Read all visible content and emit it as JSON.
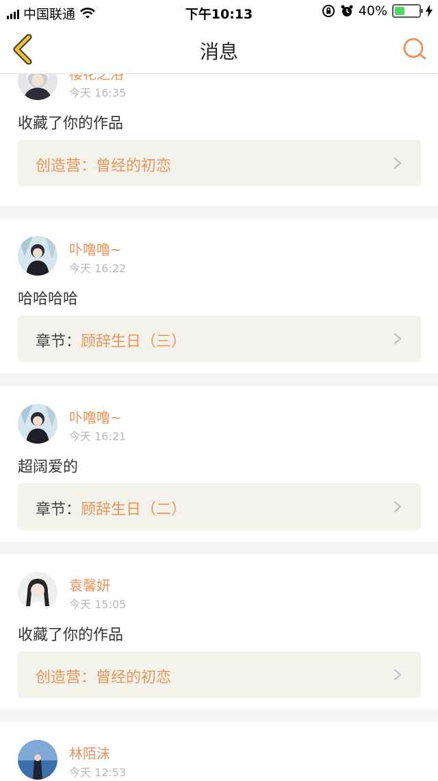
{
  "status_bar": {
    "carrier": "中国联通",
    "time": "下午10:13",
    "battery": "40%",
    "battery_level": 0.4
  },
  "nav": {
    "title": "消息"
  },
  "colors": {
    "accent": "#e8945a",
    "back_icon": "#f0c22a",
    "ref_bg": "#f3f3ec",
    "divider": "#f4f4f4"
  },
  "messages": [
    {
      "user": "樱花之洛",
      "time": "今天 16:35",
      "text": "收藏了你的作品",
      "ref_prefix": "创造营：",
      "ref_title": "曾经的初恋",
      "prefix_style": "accent",
      "avatar_icon": "avatar-girl-white-hair"
    },
    {
      "user": "卟噜噜~",
      "time": "今天 16:22",
      "text": "哈哈哈哈",
      "ref_prefix": "章节：",
      "ref_title": "顾辞生日（三）",
      "prefix_style": "dark",
      "avatar_icon": "avatar-boy-dark-suit"
    },
    {
      "user": "卟噜噜~",
      "time": "今天 16:21",
      "text": "超阔爱的",
      "ref_prefix": "章节：",
      "ref_title": "顾辞生日（二）",
      "prefix_style": "dark",
      "avatar_icon": "avatar-boy-dark-suit"
    },
    {
      "user": "袁馨妍",
      "time": "今天 15:05",
      "text": "收藏了你的作品",
      "ref_prefix": "创造营：",
      "ref_title": "曾经的初恋",
      "prefix_style": "accent",
      "avatar_icon": "avatar-girl-braids"
    },
    {
      "user": "林陌沫",
      "time": "今天 12:53",
      "text": "",
      "ref_prefix": "",
      "ref_title": "",
      "prefix_style": "accent",
      "avatar_icon": "avatar-girl-sea"
    }
  ]
}
